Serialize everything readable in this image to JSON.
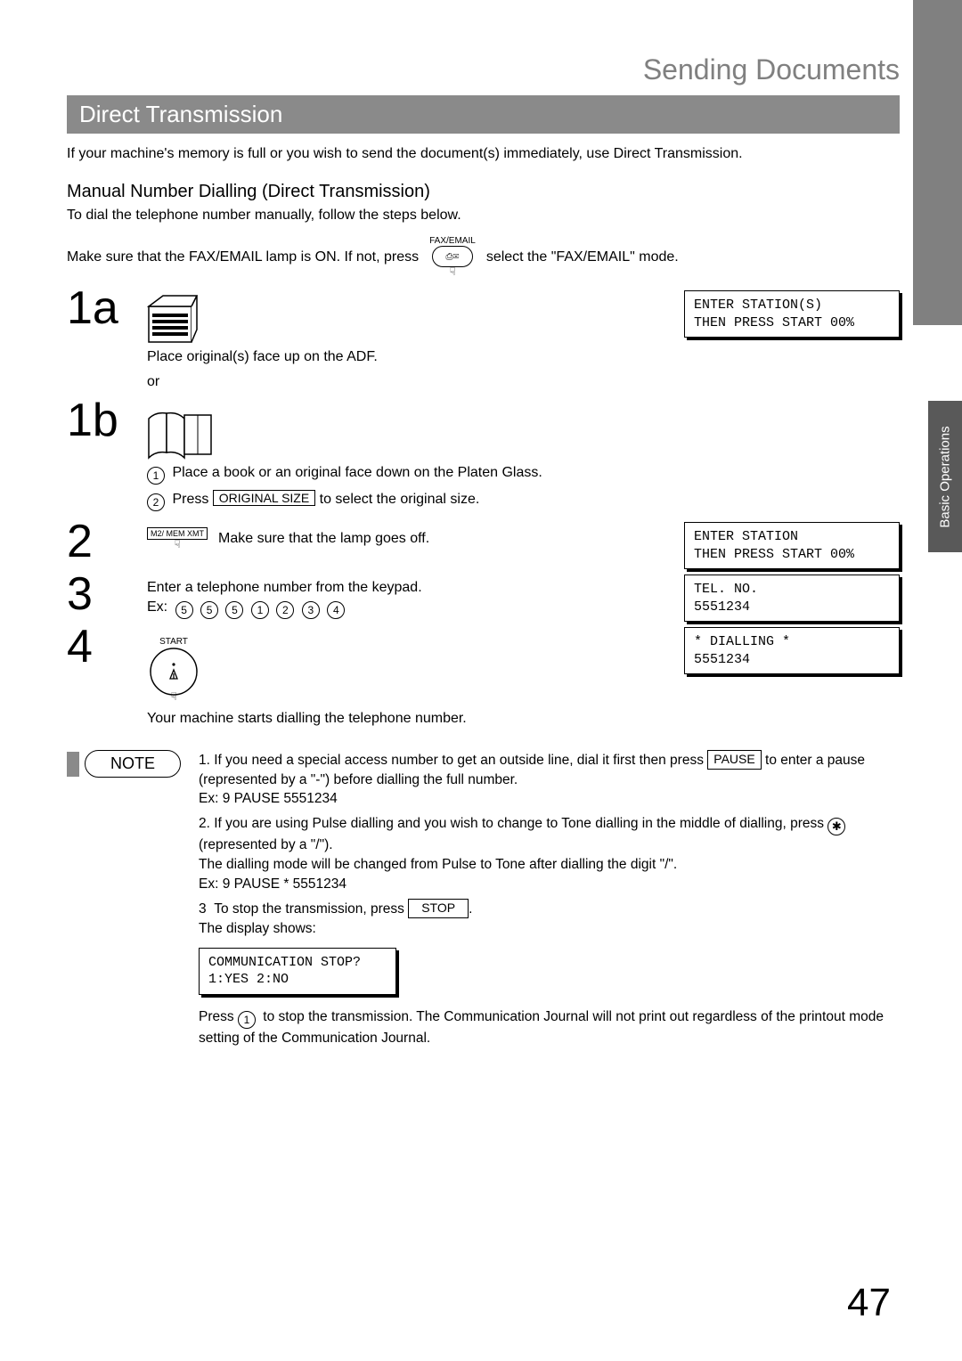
{
  "chapter": "Sending Documents",
  "section": "Direct Transmission",
  "intro": "If your machine's memory is full or you wish to send the document(s) immediately, use Direct Transmission.",
  "subhead": "Manual Number Dialling (Direct Transmission)",
  "line1": "To dial the telephone number manually, follow the steps below.",
  "line2a": "Make sure that the FAX/EMAIL lamp is ON.  If not, press",
  "line2b": "select the \"FAX/EMAIL\" mode.",
  "faxLabel": "FAX/EMAIL",
  "steps": {
    "s1a": "1a",
    "s1b": "1b",
    "s2": "2",
    "s3": "3",
    "s4": "4"
  },
  "step1a_text": "Place original(s) face up on the ADF.",
  "or": "or",
  "step1b_c1": "Place a book or an original face down on the Platen Glass.",
  "step1b_c2a": "Press ",
  "step1b_c2_key": "ORIGINAL   SIZE",
  "step1b_c2b": " to select the original size.",
  "memLabel": "M2/ MEM XMT",
  "step2_text": "Make sure that the lamp goes off.",
  "step3_text": "Enter a telephone number from the keypad.",
  "ex_label": "Ex:",
  "ex_digits": [
    "5",
    "5",
    "5",
    "1",
    "2",
    "3",
    "4"
  ],
  "startLabel": "START",
  "step4_text": "Your machine starts dialling the telephone number.",
  "lcd1": "ENTER STATION(S)\nTHEN PRESS START 00%",
  "lcd2": "ENTER STATION\nTHEN PRESS START 00%",
  "lcd3": "TEL. NO.\n5551234",
  "lcd4": "* DIALLING *\n5551234",
  "sideTab": "Basic Operations",
  "noteLabel": "NOTE",
  "note1a": "If you need a special access number to get an outside line, dial it first then press ",
  "pauseKey": "PAUSE",
  "note1b": " to enter a pause (represented by a \"-\") before dialling the full number.",
  "note1ex": "Ex: 9 PAUSE 5551234",
  "note2a": "If you are using Pulse dialling and you wish to change to Tone dialling in the middle of dialling, press ",
  "note2b": " (represented by a \"/\").",
  "note2c": "The dialling mode will be changed from Pulse to Tone after dialling the digit \"/\".",
  "note2ex": "Ex: 9 PAUSE * 5551234",
  "note3a": "To stop the transmission, press ",
  "stopKey": "STOP",
  "note3b": ".",
  "note3c": "The display shows:",
  "lcd5": "COMMUNICATION STOP?\n1:YES 2:NO",
  "note3d": "Press ",
  "note3e": " to stop the transmission. The Communication Journal will not print out regardless of the printout mode setting of the Communication Journal.",
  "pageNum": "47"
}
